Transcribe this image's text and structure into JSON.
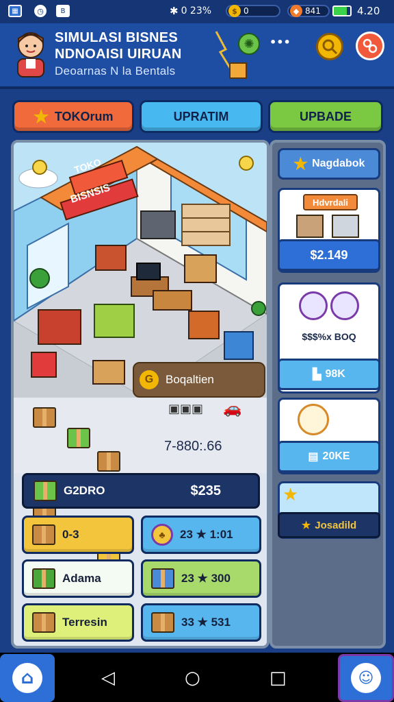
{
  "status_bar": {
    "signal_text": "0 23%",
    "coins_text": "0",
    "gems_text": "841",
    "time": "4.20"
  },
  "header": {
    "title_line1": "SIMULASI BISNES",
    "title_line2": "NDNOAISI UIRUAN",
    "subtitle": "Deoarnas N la Bentals"
  },
  "tabs": [
    {
      "label": "TOKOrum",
      "color": "#f06a3c"
    },
    {
      "label": "UPRATIM",
      "color": "#47b8f0"
    },
    {
      "label": "UPBADE",
      "color": "#7bc943"
    }
  ],
  "scene": {
    "shop_sign_1": "TOKO",
    "shop_sign_2": "BISNSIS",
    "action_badge": "Boqaltien"
  },
  "stats": {
    "score": "7-880:.66",
    "bar_label": "G2DRO",
    "bar_value": "$235"
  },
  "grid": [
    {
      "label": "0-3",
      "color": "#f2c53d"
    },
    {
      "label": "23 ★ 1:01",
      "color": "#57b6ee"
    },
    {
      "label": "Adama",
      "color": "#f4fbf2"
    },
    {
      "label": "23 ★ 300",
      "color": "#a8d96b"
    },
    {
      "label": "Terresin",
      "color": "#dff07a"
    },
    {
      "label": "33 ★ 531",
      "color": "#57b6ee"
    }
  ],
  "side": {
    "top_button": "Nagdabok",
    "card1_title": "Hdvrdali",
    "card1_price": "$2.149",
    "card2_text": "$$$%x BOQ",
    "card2_button": "98K",
    "card3_button": "20KE",
    "card4_label": "Josadild"
  },
  "colors": {
    "header_bg": "#1e4ea3",
    "accent_blue": "#2d6fd6",
    "coin_gold": "#f2b705"
  },
  "icons": [
    "home-icon",
    "back-icon",
    "circle-home-icon",
    "recent-apps-icon",
    "robot-helper-icon",
    "gear-icon",
    "help-icon",
    "lightbulb-icon"
  ]
}
